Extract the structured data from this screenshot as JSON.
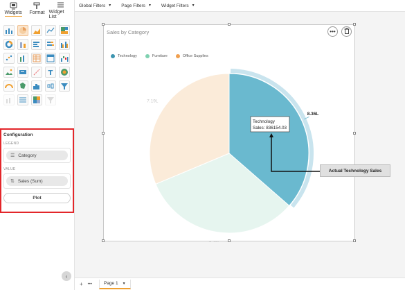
{
  "tabs": [
    {
      "label": "Widgets",
      "icon": "widgets-icon",
      "active": true
    },
    {
      "label": "Format",
      "icon": "format-icon",
      "active": false
    },
    {
      "label": "Widget List",
      "icon": "list-icon",
      "active": false
    }
  ],
  "config": {
    "title": "Configuration",
    "legend_label": "LEGEND",
    "legend_value": "Category",
    "value_label": "VALUE",
    "value_value": "Sales (Sum)",
    "plot_button": "Plot"
  },
  "filters": [
    {
      "label": "Global Filters"
    },
    {
      "label": "Page Filters"
    },
    {
      "label": "Widget Filters"
    }
  ],
  "widget": {
    "title": "Sales by Category",
    "more_icon": "more-icon",
    "delete_icon": "trash-icon"
  },
  "tooltip": {
    "line1": "Technology",
    "line2": "Sales: 836154.03"
  },
  "callout": "Actual Technology Sales",
  "bottombar": {
    "add": "+",
    "more": "•••",
    "page_label": "Page 1"
  },
  "colors": {
    "technology": "#6ab9cf",
    "furniture": "#e6f5ef",
    "office_supplies": "#fbebd9",
    "accent": "#f0a030",
    "highlight_red": "#e3262a"
  },
  "chart_data": {
    "type": "pie",
    "title": "Sales by Category",
    "legend_position": "top-left",
    "series": [
      {
        "name": "Technology",
        "value": 836154.03,
        "label": "8.36L",
        "color": "#6ab9cf",
        "highlighted": true
      },
      {
        "name": "Furniture",
        "value": 742000,
        "label": "7.42L",
        "color": "#e6f5ef",
        "highlighted": false
      },
      {
        "name": "Office Supplies",
        "value": 719000,
        "label": "7.19L",
        "color": "#fbebd9",
        "highlighted": false
      }
    ]
  }
}
